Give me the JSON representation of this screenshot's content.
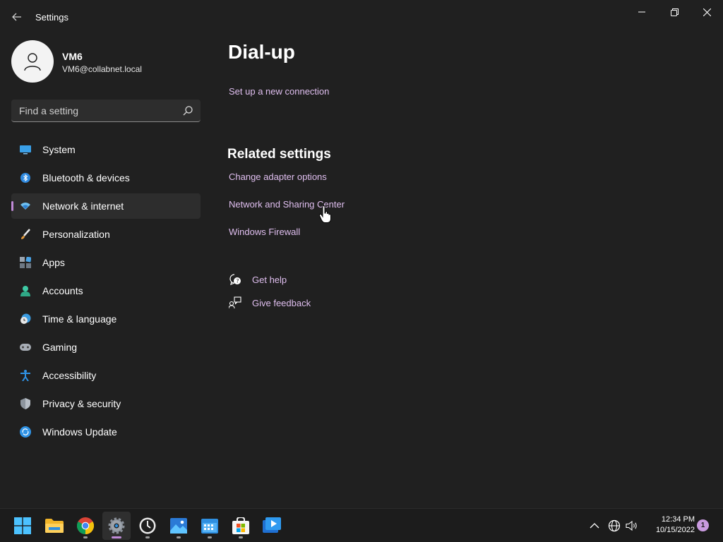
{
  "window": {
    "app_title": "Settings",
    "controls": {
      "minimize_icon": "minimize-icon",
      "maximize_icon": "restore-icon",
      "close_icon": "close-icon"
    }
  },
  "profile": {
    "name": "VM6",
    "email": "VM6@collabnet.local",
    "avatar_icon": "person-icon"
  },
  "search": {
    "placeholder": "Find a setting",
    "value": "",
    "icon": "search-icon"
  },
  "sidebar": {
    "items": [
      {
        "label": "System",
        "icon": "monitor-icon",
        "active": false
      },
      {
        "label": "Bluetooth & devices",
        "icon": "bluetooth-icon",
        "active": false
      },
      {
        "label": "Network & internet",
        "icon": "wifi-icon",
        "active": true
      },
      {
        "label": "Personalization",
        "icon": "brush-icon",
        "active": false
      },
      {
        "label": "Apps",
        "icon": "apps-icon",
        "active": false
      },
      {
        "label": "Accounts",
        "icon": "account-icon",
        "active": false
      },
      {
        "label": "Time & language",
        "icon": "globe-clock-icon",
        "active": false
      },
      {
        "label": "Gaming",
        "icon": "gamepad-icon",
        "active": false
      },
      {
        "label": "Accessibility",
        "icon": "accessibility-icon",
        "active": false
      },
      {
        "label": "Privacy & security",
        "icon": "shield-icon",
        "active": false
      },
      {
        "label": "Windows Update",
        "icon": "update-icon",
        "active": false
      }
    ]
  },
  "main": {
    "title": "Dial-up",
    "setup_link": "Set up a new connection",
    "related": {
      "heading": "Related settings",
      "links": [
        "Change adapter options",
        "Network and Sharing Center",
        "Windows Firewall"
      ]
    },
    "help": {
      "get_help": "Get help",
      "give_feedback": "Give feedback"
    }
  },
  "taskbar": {
    "apps": [
      {
        "name": "start-icon"
      },
      {
        "name": "file-explorer-icon"
      },
      {
        "name": "chrome-icon"
      },
      {
        "name": "settings-icon",
        "active": true
      },
      {
        "name": "clock-app-icon"
      },
      {
        "name": "photos-icon"
      },
      {
        "name": "calendar-icon"
      },
      {
        "name": "store-icon"
      },
      {
        "name": "media-player-icon"
      }
    ],
    "tray": {
      "time": "12:34 PM",
      "date": "10/15/2022",
      "notifications": "1"
    }
  },
  "colors": {
    "accent": "#c08ad7",
    "link": "#e0bff0",
    "background": "#202020"
  }
}
